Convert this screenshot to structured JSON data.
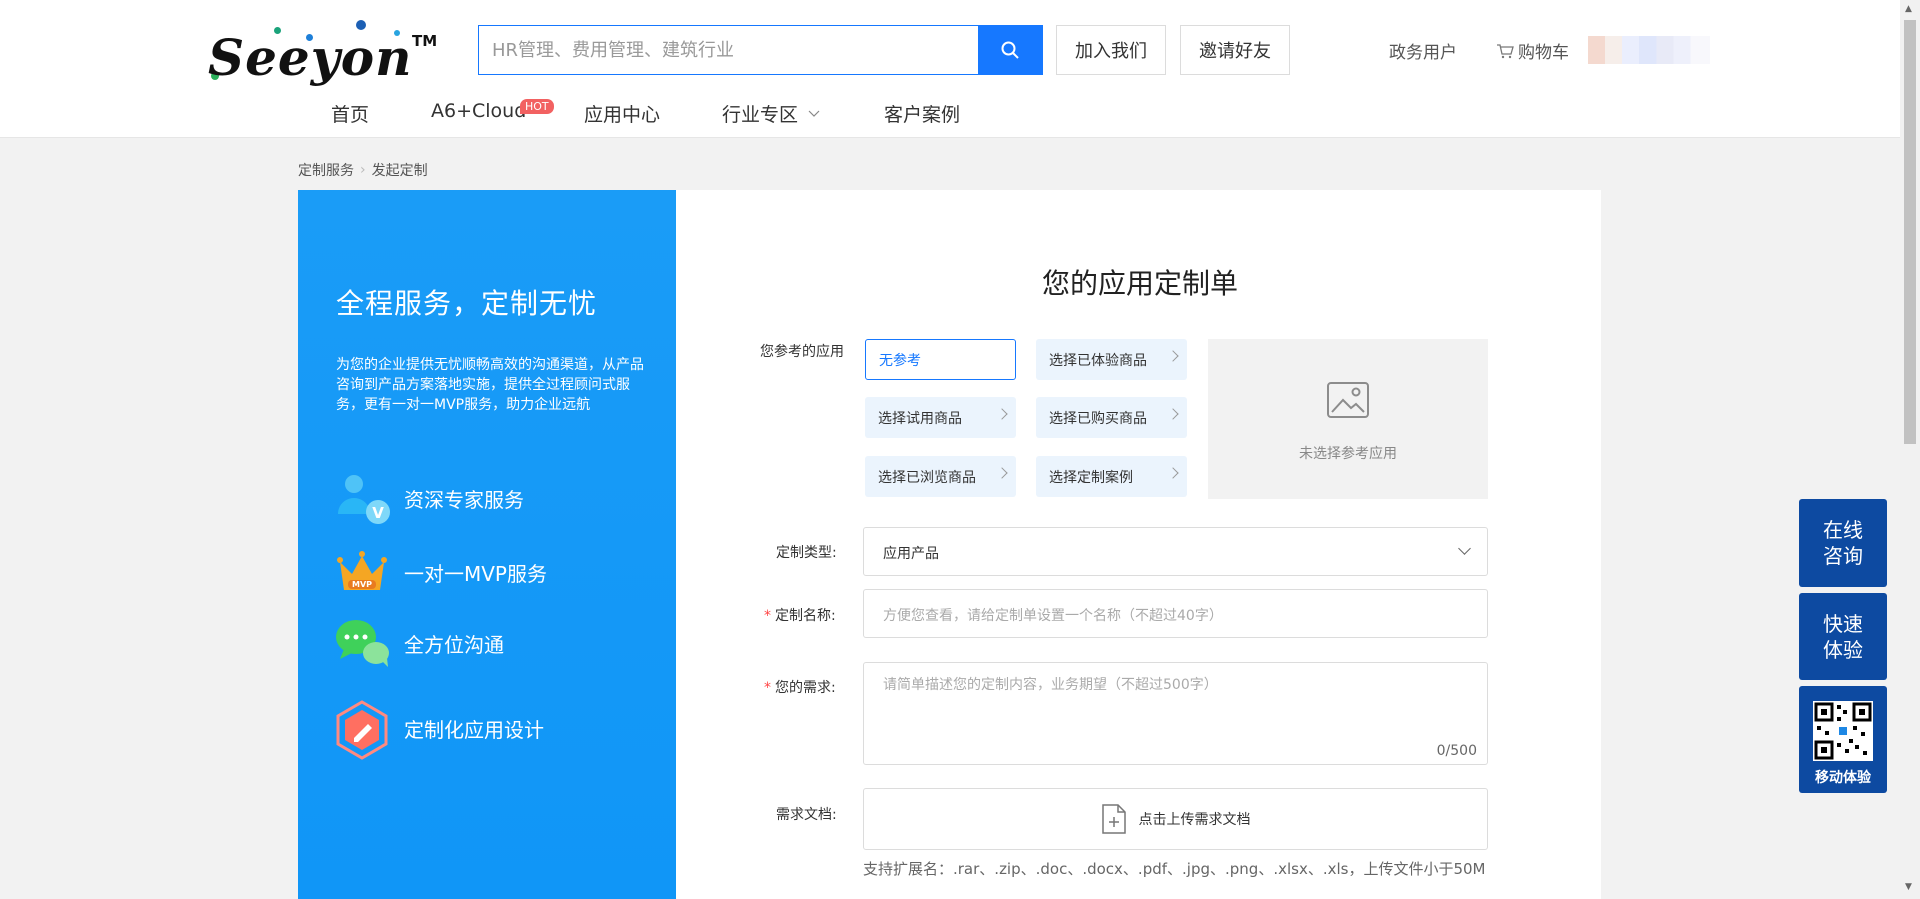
{
  "header": {
    "logo_text": "Seeyon",
    "logo_tm": "TM",
    "search_placeholder": "HR管理、费用管理、建筑行业",
    "join_label": "加入我们",
    "invite_label": "邀请好友",
    "gov_label": "政务用户",
    "cart_label": "购物车",
    "nav": [
      "首页",
      "A6+Cloud",
      "应用中心",
      "行业专区",
      "客户案例"
    ],
    "hot_badge": "HOT"
  },
  "breadcrumb": [
    "定制服务",
    "发起定制"
  ],
  "left": {
    "title": "全程服务，定制无忧",
    "desc": "为您的企业提供无忧顺畅高效的沟通渠道，从产品咨询到产品方案落地实施，提供全过程顾问式服务，更有一对一MVP服务，助力企业远航",
    "features": [
      "资深专家服务",
      "一对一MVP服务",
      "全方位沟通",
      "定制化应用设计"
    ]
  },
  "form": {
    "title": "您的应用定制单",
    "ref_label": "您参考的应用",
    "ref_options": [
      "无参考",
      "选择已体验商品",
      "选择试用商品",
      "选择已购买商品",
      "选择已浏览商品",
      "选择定制案例"
    ],
    "preview_text": "未选择参考应用",
    "type_label": "定制类型:",
    "type_value": "应用产品",
    "name_label": "定制名称:",
    "name_placeholder": "方便您查看，请给定制单设置一个名称（不超过40字）",
    "need_label": "您的需求:",
    "need_placeholder": "请简单描述您的定制内容，业务期望（不超过500字）",
    "need_count": "0/500",
    "doc_label": "需求文档:",
    "upload_text": "点击上传需求文档",
    "hint": "支持扩展名：.rar、.zip、.doc、.docx、.pdf、.jpg、.png、.xlsx、.xls，上传文件小于50M",
    "required_mark": "*"
  },
  "float": {
    "consult_1": "在线",
    "consult_2": "咨询",
    "quick_1": "快速",
    "quick_2": "体验",
    "mobile": "移动体验"
  },
  "colors": {
    "primary": "#1678ff",
    "panel": "#1096f7",
    "float": "#0d4aa1"
  }
}
